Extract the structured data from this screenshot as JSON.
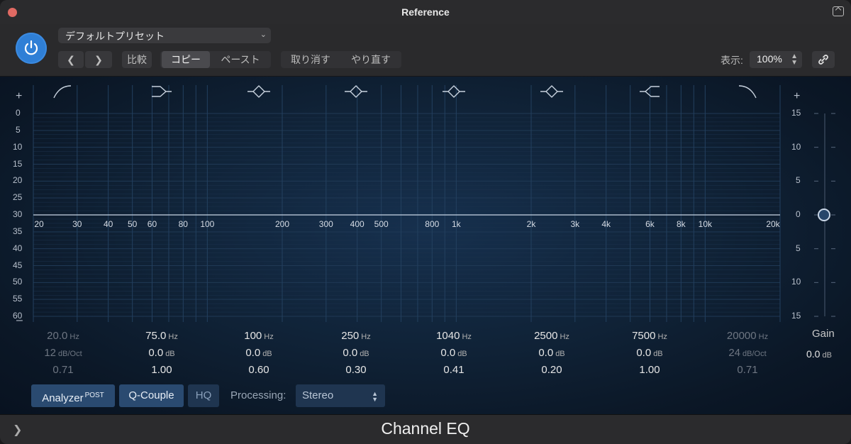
{
  "window": {
    "title": "Reference"
  },
  "header": {
    "preset": "デフォルトプリセット",
    "compare_label": "比較",
    "copy_label": "コピー",
    "paste_label": "ペースト",
    "undo_label": "取り消す",
    "redo_label": "やり直す",
    "zoom_label": "表示:",
    "zoom_value": "100%"
  },
  "graph": {
    "left_scale": [
      "0",
      "5",
      "10",
      "15",
      "20",
      "25",
      "30",
      "35",
      "40",
      "45",
      "50",
      "55",
      "60"
    ],
    "right_scale": [
      "15",
      "10",
      "5",
      "0",
      "5",
      "10",
      "15"
    ],
    "freq_labels": [
      "20",
      "30",
      "40",
      "50",
      "60",
      "80",
      "100",
      "200",
      "300",
      "400",
      "500",
      "800",
      "1k",
      "2k",
      "3k",
      "4k",
      "6k",
      "8k",
      "10k",
      "20k"
    ],
    "freq_values": [
      20,
      30,
      40,
      50,
      60,
      80,
      100,
      200,
      300,
      400,
      500,
      800,
      1000,
      2000,
      3000,
      4000,
      6000,
      8000,
      10000,
      20000
    ],
    "band_icons": [
      "low-cut-icon",
      "low-shelf-icon",
      "bell-icon",
      "bell-icon",
      "bell-icon",
      "bell-icon",
      "high-shelf-icon",
      "high-cut-icon"
    ]
  },
  "bands": [
    {
      "freq": "20.0",
      "freq_unit": "Hz",
      "gain": "12",
      "gain_unit": "dB/Oct",
      "q": "0.71",
      "active": false
    },
    {
      "freq": "75.0",
      "freq_unit": "Hz",
      "gain": "0.0",
      "gain_unit": "dB",
      "q": "1.00",
      "active": true
    },
    {
      "freq": "100",
      "freq_unit": "Hz",
      "gain": "0.0",
      "gain_unit": "dB",
      "q": "0.60",
      "active": true
    },
    {
      "freq": "250",
      "freq_unit": "Hz",
      "gain": "0.0",
      "gain_unit": "dB",
      "q": "0.30",
      "active": true
    },
    {
      "freq": "1040",
      "freq_unit": "Hz",
      "gain": "0.0",
      "gain_unit": "dB",
      "q": "0.41",
      "active": true
    },
    {
      "freq": "2500",
      "freq_unit": "Hz",
      "gain": "0.0",
      "gain_unit": "dB",
      "q": "0.20",
      "active": true
    },
    {
      "freq": "7500",
      "freq_unit": "Hz",
      "gain": "0.0",
      "gain_unit": "dB",
      "q": "1.00",
      "active": true
    },
    {
      "freq": "20000",
      "freq_unit": "Hz",
      "gain": "24",
      "gain_unit": "dB/Oct",
      "q": "0.71",
      "active": false
    }
  ],
  "gain": {
    "label": "Gain",
    "value": "0.0",
    "unit": "dB"
  },
  "controls": {
    "analyzer_label": "Analyzer",
    "analyzer_badge": "POST",
    "qcouple_label": "Q-Couple",
    "hq_label": "HQ",
    "processing_label": "Processing:",
    "processing_value": "Stereo"
  },
  "footer": {
    "title": "Channel EQ"
  },
  "colors": {
    "accent": "#2f7fd6",
    "button_active": "#2a4a70",
    "curve": "#c9d6e6"
  }
}
